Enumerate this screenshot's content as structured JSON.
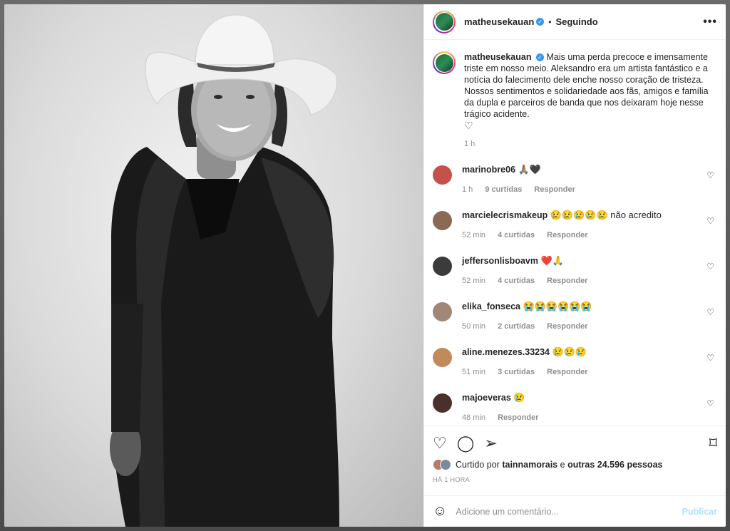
{
  "post": {
    "username": "matheusekauan",
    "follow_status": "Seguindo",
    "separator": "•",
    "more": "•••",
    "caption": "Mais uma perda precoce e imensamente triste em nosso meio. Aleksandro era um artista fantástico e a notícia do falecimento dele enche nosso coração de tristeza. Nossos sentimentos e solidariedade aos fãs, amigos e família da dupla e parceiros de banda que nos deixaram hoje nesse trágico acidente.",
    "caption_emoji": "♡",
    "time": "1 h"
  },
  "comments": [
    {
      "user": "marinobre06",
      "text": "🙏🏽🖤",
      "time": "1 h",
      "likes": "9 curtidas",
      "reply": "Responder",
      "avatar_color": "#c4514a"
    },
    {
      "user": "marcielecrismakeup",
      "text": "😢😢😢😢😢 não acredito",
      "time": "52 min",
      "likes": "4 curtidas",
      "reply": "Responder",
      "avatar_color": "#8a6a55"
    },
    {
      "user": "jeffersonlisboavm",
      "text": "❤️🙏",
      "time": "52 min",
      "likes": "4 curtidas",
      "reply": "Responder",
      "avatar_color": "#3b3b3b"
    },
    {
      "user": "elika_fonseca",
      "text": "😭😭😭😭😭😭",
      "time": "50 min",
      "likes": "2 curtidas",
      "reply": "Responder",
      "avatar_color": "#a08878"
    },
    {
      "user": "aline.menezes.33234",
      "text": "😢😢😢",
      "time": "51 min",
      "likes": "3 curtidas",
      "reply": "Responder",
      "avatar_color": "#c08a5a"
    },
    {
      "user": "majoeveras",
      "text": "😢",
      "time": "48 min",
      "likes": "",
      "reply": "Responder",
      "avatar_color": "#4a3028"
    }
  ],
  "likes": {
    "prefix": "Curtido por",
    "user": "tainnamorais",
    "middle": "e",
    "others": "outras 24.596 pessoas"
  },
  "timestamp": "HÁ 1 HORA",
  "add_comment": {
    "placeholder": "Adicione um comentário...",
    "publish": "Publicar"
  },
  "icons": {
    "like": "heart-icon",
    "comment": "comment-icon",
    "share": "send-icon",
    "save": "bookmark-icon",
    "emoji": "smiley-icon"
  }
}
